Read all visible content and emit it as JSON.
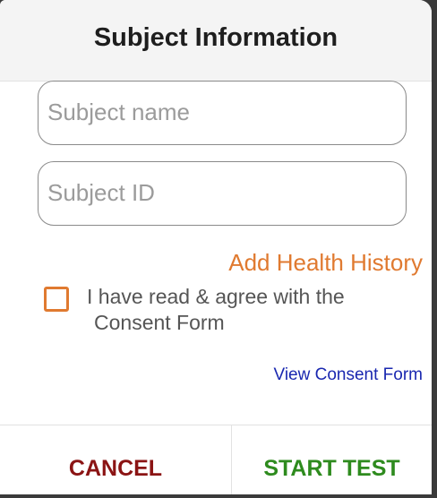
{
  "dialog": {
    "title": "Subject Information"
  },
  "form": {
    "name_placeholder": "Subject name",
    "name_value": "",
    "id_placeholder": "Subject ID",
    "id_value": "",
    "health_history_label": "Add Health History",
    "consent_line1": "I have read & agree with the",
    "consent_line2": "Consent Form",
    "consent_checked": false,
    "view_consent_label": "View Consent Form"
  },
  "actions": {
    "cancel_label": "CANCEL",
    "start_label": "START TEST"
  },
  "colors": {
    "accent_orange": "#e07a30",
    "link_blue": "#1a28b0",
    "cancel_red": "#8b1414",
    "start_green": "#2e8b1e"
  }
}
